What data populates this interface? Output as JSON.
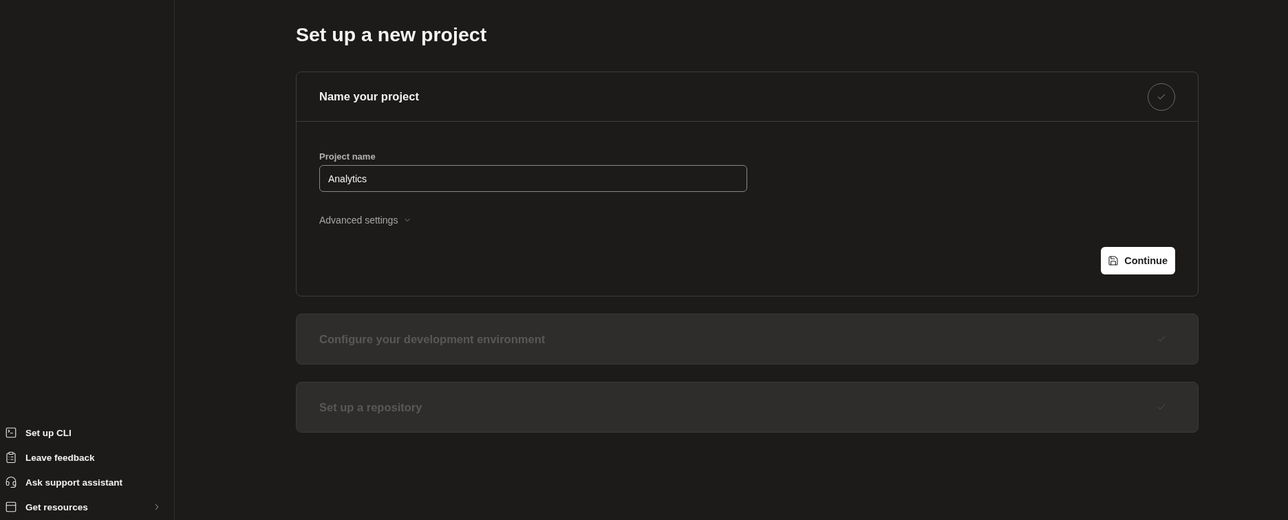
{
  "sidebar": {
    "items": [
      {
        "label": "Set up CLI",
        "has_submenu": false
      },
      {
        "label": "Leave feedback",
        "has_submenu": false
      },
      {
        "label": "Ask support assistant",
        "has_submenu": false
      },
      {
        "label": "Get resources",
        "has_submenu": true
      }
    ]
  },
  "page_title": "Set up a new project",
  "steps": [
    {
      "title": "Name your project",
      "expanded": true,
      "disabled": false,
      "form": {
        "field": {
          "label": "Project name",
          "value": "Analytics"
        },
        "advanced": {
          "label": "Advanced settings",
          "expanded": false
        },
        "button": {
          "label": "Continue"
        }
      }
    },
    {
      "title": "Configure your development environment",
      "expanded": false,
      "disabled": true
    },
    {
      "title": "Set up a repository",
      "expanded": false,
      "disabled": true
    }
  ]
}
